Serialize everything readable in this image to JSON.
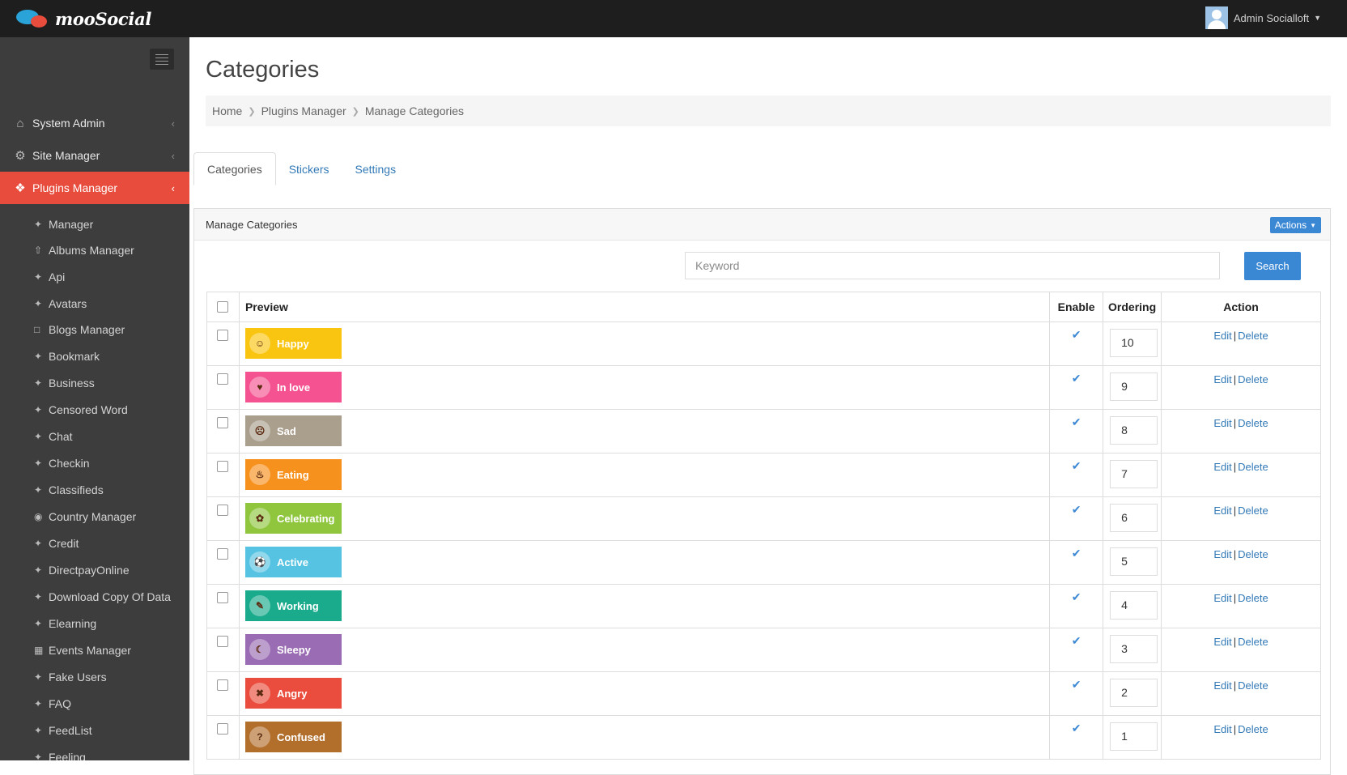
{
  "app": {
    "brand": "mooSocial",
    "user_name": "Admin Socialloft"
  },
  "sidebar": {
    "main": [
      {
        "label": "System Admin",
        "icon": "home-icon",
        "active": false
      },
      {
        "label": "Site Manager",
        "icon": "gears-icon",
        "active": false
      },
      {
        "label": "Plugins Manager",
        "icon": "tags-icon",
        "active": true
      }
    ],
    "sub": [
      {
        "label": "Manager",
        "icon": "tag-icon"
      },
      {
        "label": "Albums Manager",
        "icon": "upload-icon"
      },
      {
        "label": "Api",
        "icon": "tag-icon"
      },
      {
        "label": "Avatars",
        "icon": "tag-icon"
      },
      {
        "label": "Blogs Manager",
        "icon": "comment-icon"
      },
      {
        "label": "Bookmark",
        "icon": "tag-icon"
      },
      {
        "label": "Business",
        "icon": "tag-icon"
      },
      {
        "label": "Censored Word",
        "icon": "tag-icon"
      },
      {
        "label": "Chat",
        "icon": "tag-icon"
      },
      {
        "label": "Checkin",
        "icon": "tag-icon"
      },
      {
        "label": "Classifieds",
        "icon": "tag-icon"
      },
      {
        "label": "Country Manager",
        "icon": "globe-icon"
      },
      {
        "label": "Credit",
        "icon": "tag-icon"
      },
      {
        "label": "DirectpayOnline",
        "icon": "tag-icon"
      },
      {
        "label": "Download Copy Of Data",
        "icon": "tag-icon"
      },
      {
        "label": "Elearning",
        "icon": "tag-icon"
      },
      {
        "label": "Events Manager",
        "icon": "calendar-icon"
      },
      {
        "label": "Fake Users",
        "icon": "tag-icon"
      },
      {
        "label": "FAQ",
        "icon": "tag-icon"
      },
      {
        "label": "FeedList",
        "icon": "tag-icon"
      },
      {
        "label": "Feeling",
        "icon": "tag-icon"
      }
    ]
  },
  "page": {
    "title": "Categories",
    "breadcrumb": [
      "Home",
      "Plugins Manager",
      "Manage Categories"
    ],
    "tabs": [
      {
        "label": "Categories",
        "active": true
      },
      {
        "label": "Stickers",
        "active": false
      },
      {
        "label": "Settings",
        "active": false
      }
    ]
  },
  "panel": {
    "title": "Manage Categories",
    "actions_label": "Actions",
    "search_placeholder": "Keyword",
    "search_label": "Search"
  },
  "table": {
    "headers": {
      "preview": "Preview",
      "enable": "Enable",
      "ordering": "Ordering",
      "action": "Action"
    },
    "edit_label": "Edit",
    "delete_label": "Delete",
    "separator": "|",
    "rows": [
      {
        "name": "Happy",
        "color": "#f9c510",
        "enabled": true,
        "ordering": "10"
      },
      {
        "name": "In love",
        "color": "#f45290",
        "enabled": true,
        "ordering": "9"
      },
      {
        "name": "Sad",
        "color": "#aa9e8d",
        "enabled": true,
        "ordering": "8"
      },
      {
        "name": "Eating",
        "color": "#f7911d",
        "enabled": true,
        "ordering": "7"
      },
      {
        "name": "Celebrating",
        "color": "#8fc63e",
        "enabled": true,
        "ordering": "6"
      },
      {
        "name": "Active",
        "color": "#56c3e2",
        "enabled": true,
        "ordering": "5"
      },
      {
        "name": "Working",
        "color": "#1aab8d",
        "enabled": true,
        "ordering": "4"
      },
      {
        "name": "Sleepy",
        "color": "#9a6cb3",
        "enabled": true,
        "ordering": "3"
      },
      {
        "name": "Angry",
        "color": "#ea4d3d",
        "enabled": true,
        "ordering": "2"
      },
      {
        "name": "Confused",
        "color": "#b26f2c",
        "enabled": true,
        "ordering": "1"
      }
    ]
  }
}
